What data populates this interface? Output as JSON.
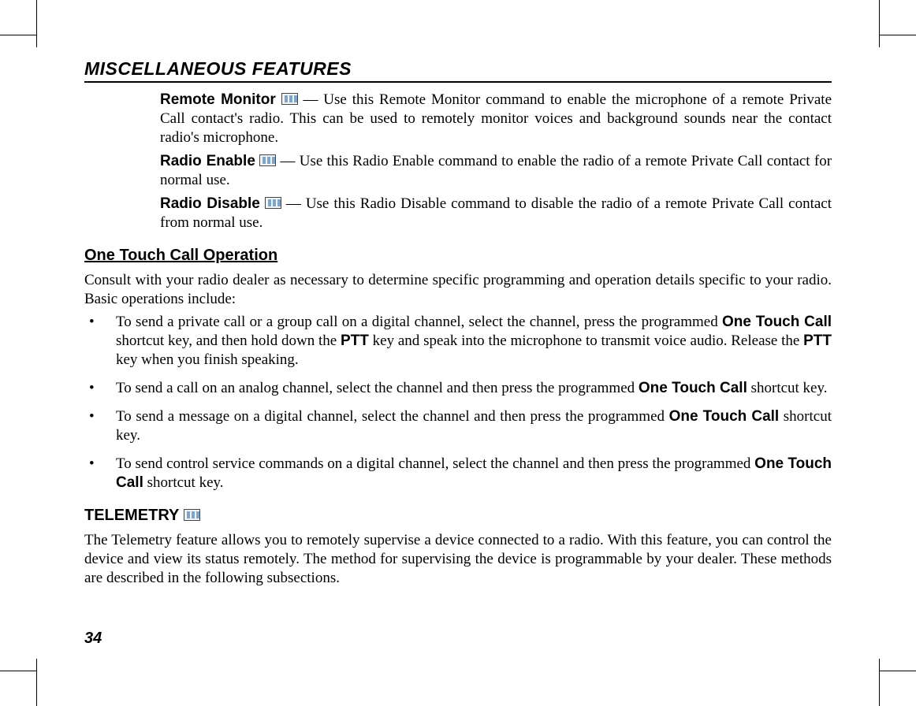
{
  "header": "MISCELLANEOUS FEATURES",
  "remote_monitor": {
    "title": "Remote Monitor",
    "body": "— Use this Remote Monitor command to enable the microphone of a remote Private Call contact's radio. This can be used to remotely monitor voices and background sounds near the contact radio's microphone."
  },
  "radio_enable": {
    "title": "Radio Enable",
    "body": "— Use this Radio Enable command to enable the radio of a remote Private Call contact for normal use."
  },
  "radio_disable": {
    "title": "Radio Disable",
    "body": "— Use this Radio Disable command to disable the radio of a remote Private Call contact from normal use."
  },
  "onetouch": {
    "heading": "One Touch Call Operation",
    "intro": "Consult with your radio dealer as necessary to determine specific programming and operation details specific to your radio. Basic operations include:",
    "bullets": {
      "b1_a": "To send a private call or a group call on a digital channel, select the channel, press the programmed ",
      "b1_bold1": "One Touch Call",
      "b1_b": " shortcut key, and then hold down the ",
      "b1_bold2": "PTT",
      "b1_c": " key and speak into the microphone to transmit voice audio. Release the ",
      "b1_bold3": "PTT",
      "b1_d": " key when you finish speaking.",
      "b2_a": "To send a call on an analog channel, select the channel and then press the programmed ",
      "b2_bold": "One Touch Call",
      "b2_b": " shortcut key.",
      "b3_a": "To send a message on a digital channel, select the channel and then press the programmed ",
      "b3_bold": "One Touch Call",
      "b3_b": " shortcut key.",
      "b4_a": "To send control service commands on a digital channel, select the channel and then press the programmed ",
      "b4_bold": "One Touch Call",
      "b4_b": " shortcut key."
    }
  },
  "telemetry": {
    "heading": "TELEMETRY",
    "body": "The Telemetry feature allows you to remotely supervise a device connected to a radio. With this feature, you can control the device and view its status remotely. The method for supervising the device is programmable by your dealer. These methods are described in the following subsections."
  },
  "page_number": "34"
}
